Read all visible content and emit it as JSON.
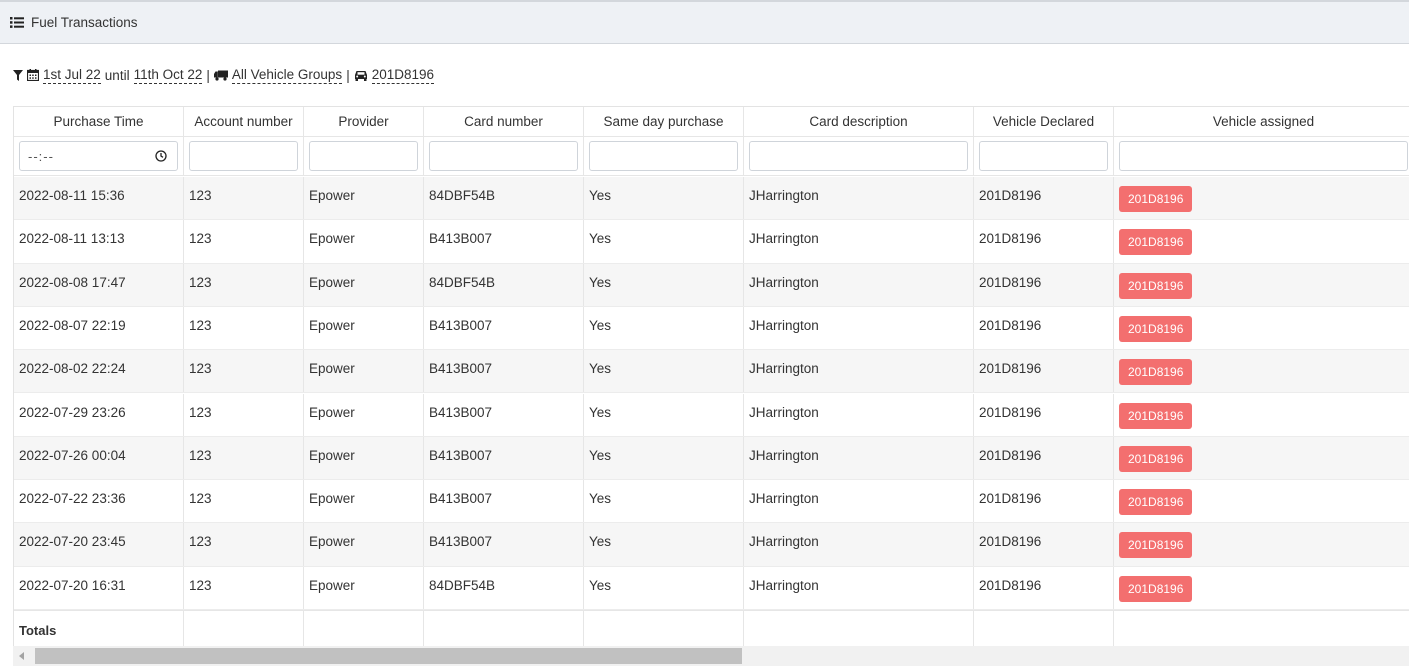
{
  "header": {
    "title": "Fuel Transactions",
    "icon": "list-icon"
  },
  "filters": {
    "date_from": "1st Jul 22",
    "until_label": "until",
    "date_to": "11th Oct 22",
    "separator": "|",
    "vehicle_group": "All Vehicle Groups",
    "vehicle": "201D8196"
  },
  "table": {
    "columns": [
      "Purchase Time",
      "Account number",
      "Provider",
      "Card number",
      "Same day purchase",
      "Card description",
      "Vehicle Declared",
      "Vehicle assigned"
    ],
    "time_filter_placeholder": "--:--",
    "rows": [
      [
        "2022-08-11 15:36",
        "123",
        "Epower",
        "84DBF54B",
        "Yes",
        "JHarrington",
        "201D8196",
        "201D8196"
      ],
      [
        "2022-08-11 13:13",
        "123",
        "Epower",
        "B413B007",
        "Yes",
        "JHarrington",
        "201D8196",
        "201D8196"
      ],
      [
        "2022-08-08 17:47",
        "123",
        "Epower",
        "84DBF54B",
        "Yes",
        "JHarrington",
        "201D8196",
        "201D8196"
      ],
      [
        "2022-08-07 22:19",
        "123",
        "Epower",
        "B413B007",
        "Yes",
        "JHarrington",
        "201D8196",
        "201D8196"
      ],
      [
        "2022-08-02 22:24",
        "123",
        "Epower",
        "B413B007",
        "Yes",
        "JHarrington",
        "201D8196",
        "201D8196"
      ],
      [
        "2022-07-29 23:26",
        "123",
        "Epower",
        "B413B007",
        "Yes",
        "JHarrington",
        "201D8196",
        "201D8196"
      ],
      [
        "2022-07-26 00:04",
        "123",
        "Epower",
        "B413B007",
        "Yes",
        "JHarrington",
        "201D8196",
        "201D8196"
      ],
      [
        "2022-07-22 23:36",
        "123",
        "Epower",
        "B413B007",
        "Yes",
        "JHarrington",
        "201D8196",
        "201D8196"
      ],
      [
        "2022-07-20 23:45",
        "123",
        "Epower",
        "B413B007",
        "Yes",
        "JHarrington",
        "201D8196",
        "201D8196"
      ],
      [
        "2022-07-20 16:31",
        "123",
        "Epower",
        "84DBF54B",
        "Yes",
        "JHarrington",
        "201D8196",
        "201D8196"
      ]
    ],
    "totals_label": "Totals"
  },
  "colors": {
    "badge": "#f36f6f",
    "header_bg": "#eef1f5",
    "row_alt": "#f6f6f6"
  }
}
